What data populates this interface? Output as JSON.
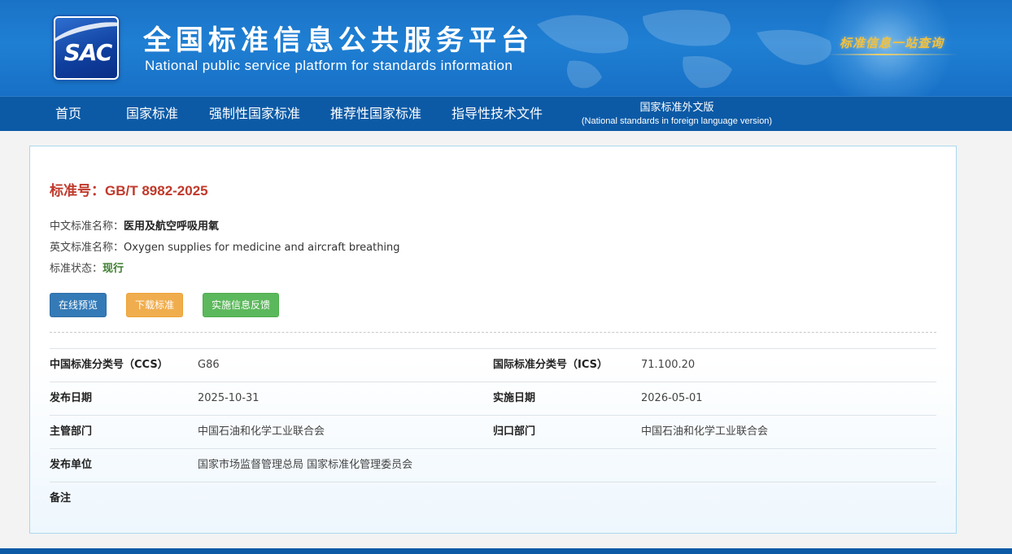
{
  "header": {
    "logo_text": "SAC",
    "title_cn": "全国标准信息公共服务平台",
    "title_en": "National public service platform  for standards information",
    "slogan": "标准信息一站查询"
  },
  "nav": {
    "items": [
      {
        "label": "首页"
      },
      {
        "label": "国家标准"
      },
      {
        "label": "强制性国家标准"
      },
      {
        "label": "推荐性国家标准"
      },
      {
        "label": "指导性技术文件"
      }
    ],
    "foreign": {
      "label_cn": "国家标准外文版",
      "label_en": "(National standards in foreign language version)"
    }
  },
  "standard": {
    "number_label": "标准号：GB/T 8982-2025",
    "cn_name_label": "中文标准名称：",
    "cn_name": "医用及航空呼吸用氧",
    "en_name_label": "英文标准名称：",
    "en_name": "Oxygen supplies for medicine and aircraft breathing",
    "status_label": "标准状态：",
    "status": "现行"
  },
  "buttons": {
    "preview": "在线预览",
    "download": "下载标准",
    "feedback": "实施信息反馈"
  },
  "details": {
    "rows": [
      {
        "k1": "中国标准分类号（CCS）",
        "v1": "G86",
        "k2": "国际标准分类号（ICS）",
        "v2": "71.100.20"
      },
      {
        "k1": "发布日期",
        "v1": "2025-10-31",
        "k2": "实施日期",
        "v2": "2026-05-01"
      },
      {
        "k1": "主管部门",
        "v1": "中国石油和化学工业联合会",
        "k2": "归口部门",
        "v2": "中国石油和化学工业联合会"
      },
      {
        "k1": "发布单位",
        "v1": "国家市场监督管理总局 国家标准化管理委员会",
        "k2": "",
        "v2": ""
      },
      {
        "k1": "备注",
        "v1": "",
        "k2": "",
        "v2": ""
      }
    ]
  },
  "colors": {
    "banner": "#1f7fd3",
    "nav": "#0c5aa6",
    "std_number": "#c0392b",
    "status_current": "#3b7d2e",
    "btn_preview": "#337ab7",
    "btn_download": "#f0ad4e",
    "btn_feedback": "#5cb85c"
  }
}
